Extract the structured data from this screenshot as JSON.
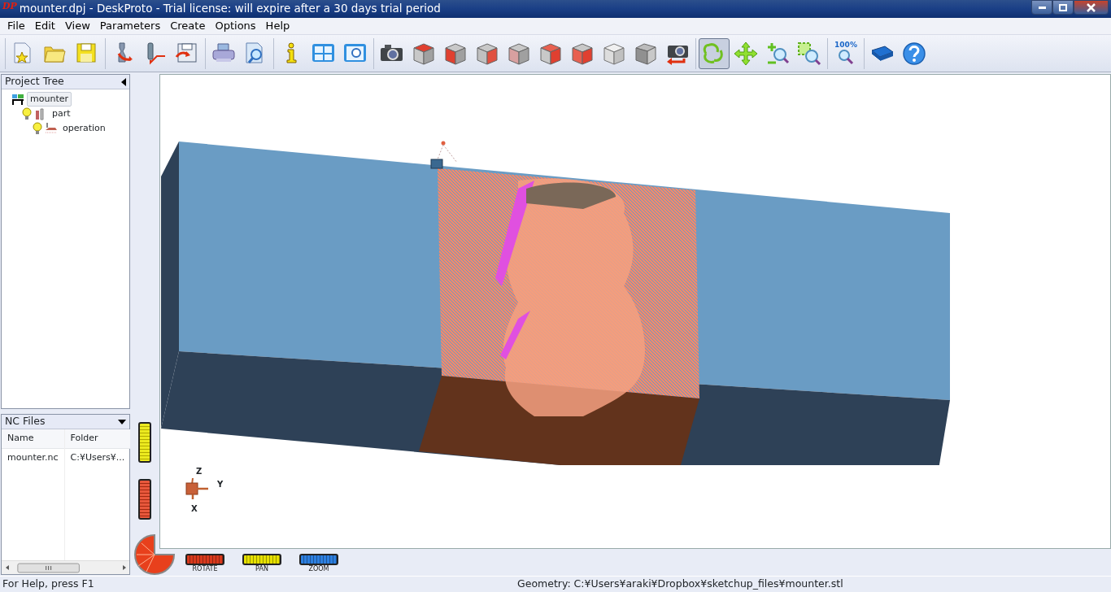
{
  "window": {
    "app_icon": "DP",
    "title": "mounter.dpj - DeskProto - Trial license: will expire after a 30 days trial period"
  },
  "menu": [
    "File",
    "Edit",
    "View",
    "Parameters",
    "Create",
    "Options",
    "Help"
  ],
  "toolbar_groups": [
    [
      {
        "selected": false
      },
      {
        "selected": false
      },
      {
        "selected": false
      }
    ],
    [
      {
        "selected": false
      },
      {
        "selected": false
      },
      {
        "selected": false
      }
    ],
    [
      {
        "selected": false
      },
      {
        "selected": false
      }
    ],
    [
      {
        "selected": false
      },
      {
        "selected": false
      },
      {
        "selected": false
      }
    ],
    [
      {
        "selected": false
      },
      {
        "selected": false
      },
      {
        "selected": false
      },
      {
        "selected": false
      },
      {
        "selected": false
      },
      {
        "selected": false
      },
      {
        "selected": false
      },
      {
        "selected": false
      },
      {
        "selected": false
      },
      {
        "selected": false
      }
    ],
    [
      {
        "selected": true
      },
      {
        "selected": false
      },
      {
        "selected": false
      },
      {
        "selected": false
      }
    ],
    [
      {
        "selected": false,
        "label": "100%"
      }
    ],
    [
      {
        "selected": false
      },
      {
        "selected": false
      }
    ]
  ],
  "project_tree": {
    "title": "Project Tree",
    "items": [
      {
        "label": "mounter",
        "selected": true,
        "children": [
          {
            "label": "part",
            "selected": false,
            "visible": true,
            "children": [
              {
                "label": "operation",
                "selected": false,
                "visible": true
              }
            ]
          }
        ]
      }
    ]
  },
  "nc_files": {
    "title": "NC Files",
    "columns": [
      "Name",
      "Folder"
    ],
    "rows": [
      [
        "mounter.nc",
        "C:¥Users¥..."
      ]
    ]
  },
  "viewport": {
    "axes": [
      "Z",
      "Y",
      "X"
    ]
  },
  "wheels": [
    {
      "label": "ROTATE",
      "color": "#d8391c"
    },
    {
      "label": "PAN",
      "color": "#e6e000"
    },
    {
      "label": "ZOOM",
      "color": "#2c7fe0"
    }
  ],
  "status_bar": [
    "For Help, press F1",
    "Geometry: C:¥Users¥araki¥Dropbox¥sketchup_files¥mounter.stl"
  ]
}
